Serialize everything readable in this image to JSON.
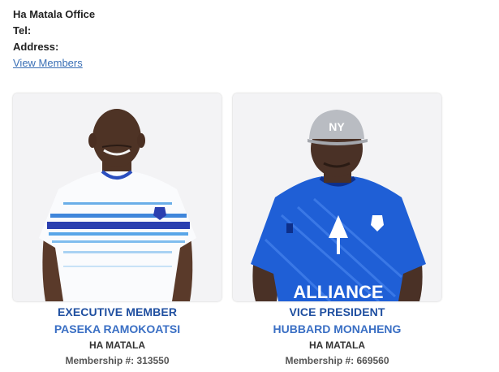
{
  "office": {
    "name": "Ha Matala Office",
    "tel_label": "Tel:",
    "address_label": "Address:",
    "view_members_link": "View Members"
  },
  "members": [
    {
      "role": "EXECUTIVE MEMBER",
      "name": "PASEKA RAMOKOATSI",
      "branch": "HA MATALA",
      "membership": "Membership #: 313550"
    },
    {
      "role": "VICE PRESIDENT",
      "name": "HUBBARD MONAHENG",
      "branch": "HA MATALA",
      "membership": "Membership #: 669560",
      "shirt_text": "ALLIANCE",
      "cap_logo": "NY"
    }
  ],
  "colors": {
    "role_text": "#1f4fa0",
    "name_text": "#3a6fc4",
    "link": "#3a6fb5",
    "jersey_blue": "#1f5fd6"
  }
}
